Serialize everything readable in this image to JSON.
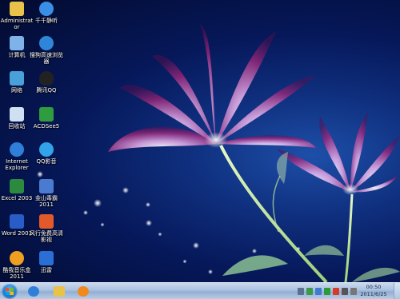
{
  "desktop": {
    "icons": [
      {
        "name": "administrator-folder-icon",
        "label": "Administrator",
        "color": "#e9c24a"
      },
      {
        "name": "qianqian-player-icon",
        "label": "千千静听",
        "color": "#3a8ee6"
      },
      {
        "name": "computer-icon",
        "label": "计算机",
        "color": "#7fb2e8"
      },
      {
        "name": "sogou-browser-icon",
        "label": "搜狗高速浏览器",
        "color": "#2f86d8"
      },
      {
        "name": "network-icon",
        "label": "网络",
        "color": "#4aa0d8"
      },
      {
        "name": "tencent-qq-icon",
        "label": "腾讯QQ",
        "color": "#222222"
      },
      {
        "name": "recycle-bin-icon",
        "label": "回收站",
        "color": "#cfe0f2"
      },
      {
        "name": "acdsee-icon",
        "label": "ACDSee5",
        "color": "#2e9c3f"
      },
      {
        "name": "internet-explorer-icon",
        "label": "Internet Explorer",
        "color": "#2f7fd8"
      },
      {
        "name": "qq-video-icon",
        "label": "QQ影音",
        "color": "#32a3e8"
      },
      {
        "name": "excel-icon",
        "label": "Excel 2003",
        "color": "#2b8a3e"
      },
      {
        "name": "jinshan-antivirus-icon",
        "label": "金山毒霸2011",
        "color": "#4a7bd1"
      },
      {
        "name": "word-icon",
        "label": "Word 2003",
        "color": "#2a5cc7"
      },
      {
        "name": "baofeng-player-icon",
        "label": "风行免费高清影视",
        "color": "#e25a2a"
      },
      {
        "name": "kuwo-music-icon",
        "label": "酷我音乐盒2011",
        "color": "#f0a020"
      },
      {
        "name": "xunlei-icon",
        "label": "迅雷",
        "color": "#2a6fd4"
      }
    ]
  },
  "taskbar": {
    "pinned": [
      {
        "name": "ie-taskbar-icon",
        "color": "#2f7fd8"
      },
      {
        "name": "explorer-folder-taskbar-icon",
        "color": "#e9c24a"
      },
      {
        "name": "media-player-taskbar-icon",
        "color": "#f08a1e"
      }
    ],
    "tray": [
      {
        "name": "tray-icon-1",
        "color": "#5b6f8e"
      },
      {
        "name": "tray-icon-2",
        "color": "#3a9a4a"
      },
      {
        "name": "tray-icon-3",
        "color": "#d83a2a"
      },
      {
        "name": "tray-icon-4",
        "color": "#2a6fd4"
      },
      {
        "name": "tray-icon-5",
        "color": "#444444"
      },
      {
        "name": "tray-icon-6",
        "color": "#666666"
      },
      {
        "name": "tray-icon-7",
        "color": "#777777"
      }
    ],
    "clock": {
      "time": "00:50",
      "date": "2011/6/25"
    }
  }
}
